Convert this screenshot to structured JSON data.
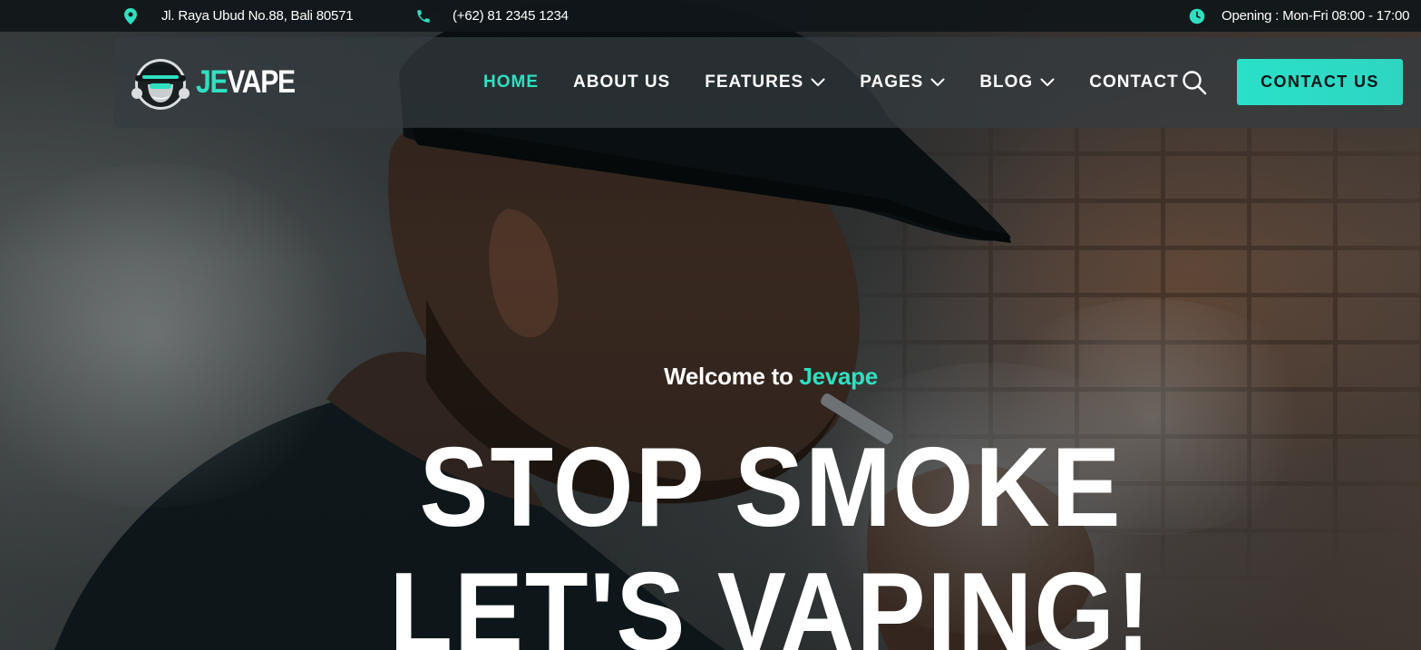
{
  "topbar": {
    "address": "Jl. Raya Ubud No.88, Bali 80571",
    "phone": "(+62) 81 2345 1234",
    "hours": "Opening : Mon-Fri 08:00 - 17:00"
  },
  "brand": {
    "logo_prefix": "JE",
    "logo_suffix": "VAPE"
  },
  "nav": {
    "items": [
      {
        "label": "HOME",
        "active": true,
        "dropdown": false
      },
      {
        "label": "ABOUT US",
        "active": false,
        "dropdown": false
      },
      {
        "label": "FEATURES",
        "active": false,
        "dropdown": true
      },
      {
        "label": "PAGES",
        "active": false,
        "dropdown": true
      },
      {
        "label": "BLOG",
        "active": false,
        "dropdown": true
      },
      {
        "label": "CONTACT",
        "active": false,
        "dropdown": false
      }
    ],
    "cta_label": "CONTACT US"
  },
  "hero": {
    "welcome_prefix": "Welcome to ",
    "welcome_brand": "Jevape",
    "headline_line1": "STOP SMOKE",
    "headline_line2": "LET'S VAPING!"
  },
  "icons": {
    "address": "map-pin-icon",
    "phone": "phone-icon",
    "hours": "clock-icon",
    "search": "search-icon",
    "dropdown": "chevron-down-icon"
  },
  "colors": {
    "accent": "#2fe0c0",
    "text": "#ffffff",
    "cta_text": "#0d1517"
  }
}
